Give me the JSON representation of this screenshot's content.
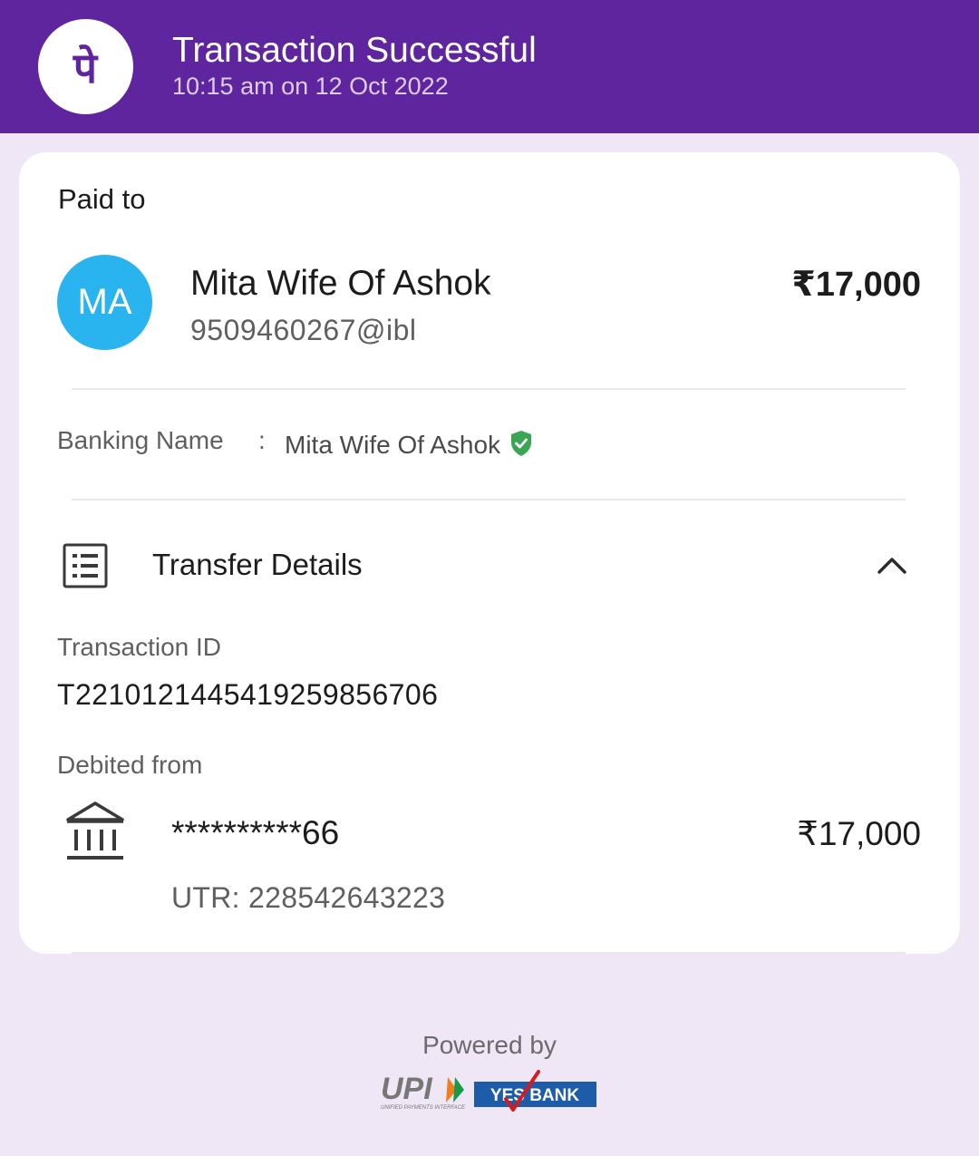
{
  "header": {
    "logo_glyph": "पे",
    "title": "Transaction Successful",
    "subtitle": "10:15 am on 12 Oct 2022",
    "color": "#5f259f"
  },
  "payment": {
    "section_label": "Paid to",
    "avatar_initials": "MA",
    "avatar_color": "#29b3ef",
    "payee_name": "Mita Wife Of Ashok",
    "payee_upi": "9509460267@ibl",
    "amount": "₹17,000"
  },
  "banking": {
    "label": "Banking Name",
    "separator": ":",
    "value": "Mita Wife Of Ashok",
    "verified_icon": "verified-shield-icon"
  },
  "transfer_details": {
    "title": "Transfer Details",
    "icon": "list-document-icon",
    "toggle_icon": "chevron-up-icon",
    "transaction_id_label": "Transaction ID",
    "transaction_id": "T2210121445419259856706",
    "debited_from_label": "Debited from",
    "bank_icon": "bank-icon",
    "account_masked": "**********66",
    "debit_amount": "₹17,000",
    "utr": "UTR: 228542643223"
  },
  "footer": {
    "powered_by": "Powered by",
    "upi_logo_text": "UPI",
    "upi_tagline": "UNIFIED PAYMENTS INTERFACE",
    "bank_logo_text": "YES BANK"
  }
}
